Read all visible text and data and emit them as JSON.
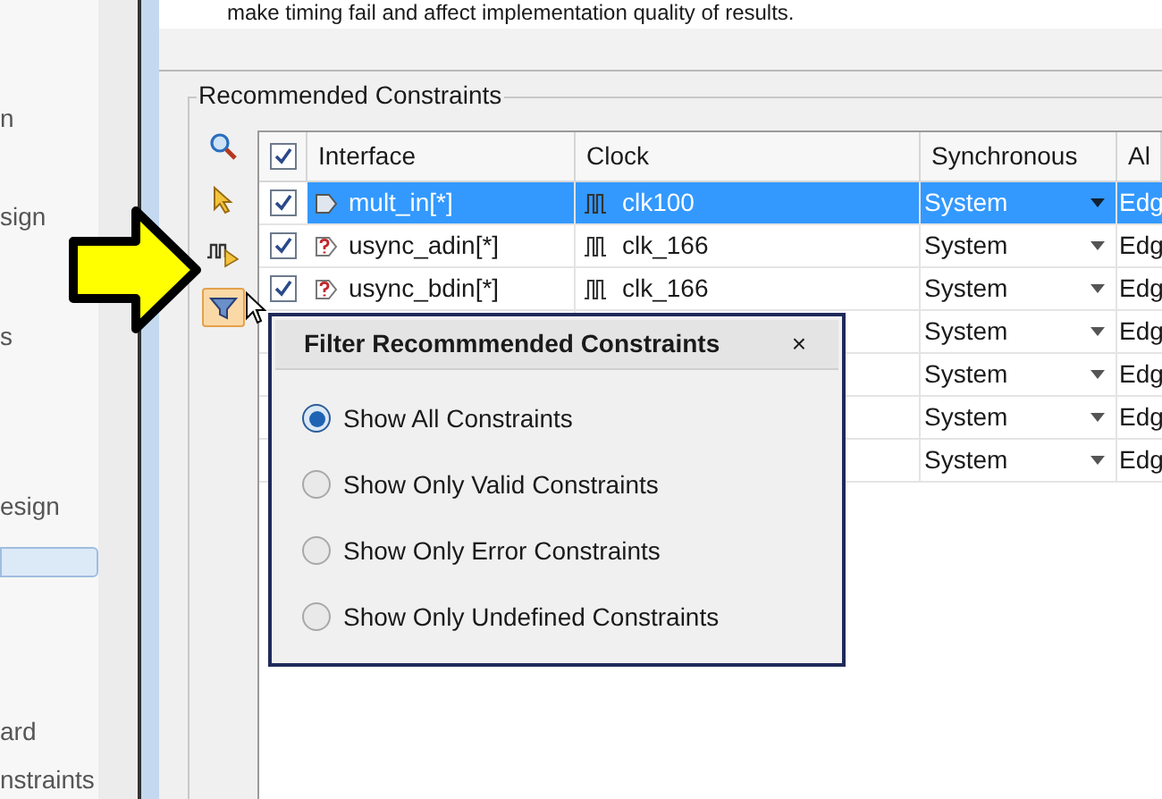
{
  "intro_text": "make timing fail and affect implementation quality of results.",
  "sidebar": {
    "items": [
      {
        "kind": "text",
        "label": "n",
        "selected": false
      },
      {
        "kind": "text",
        "label": "sign",
        "selected": false
      },
      {
        "kind": "text",
        "label": "s",
        "selected": false
      },
      {
        "kind": "text",
        "label": "esign",
        "selected": false
      },
      {
        "kind": "blank",
        "selected": true
      },
      {
        "kind": "text",
        "label": "ard",
        "selected": false
      },
      {
        "kind": "text",
        "label": "nstraints",
        "selected": false
      }
    ]
  },
  "group_title": "Recommended Constraints",
  "toolbar": [
    {
      "kind": "search",
      "active": false
    },
    {
      "kind": "select",
      "active": false
    },
    {
      "kind": "clock",
      "active": false
    },
    {
      "kind": "filter",
      "active": true
    }
  ],
  "table": {
    "header_checked": true,
    "columns": [
      "Interface",
      "Clock",
      "Synchronous",
      "Al"
    ],
    "rows": [
      {
        "checked": true,
        "selected": true,
        "kind": "valid",
        "interface": "mult_in[*]",
        "clock": "clk100",
        "synchronous": "System",
        "column_5": "Edg"
      },
      {
        "checked": true,
        "selected": false,
        "kind": "error",
        "interface": "usync_adin[*]",
        "clock": "clk_166",
        "synchronous": "System",
        "column_5": "Edg"
      },
      {
        "checked": true,
        "selected": false,
        "kind": "error",
        "interface": "usync_bdin[*]",
        "clock": "clk_166",
        "synchronous": "System",
        "column_5": "Edg"
      },
      {
        "selected": false,
        "kind": "hidden",
        "synchronous": "System",
        "column_5": "Edg"
      },
      {
        "selected": false,
        "kind": "hidden",
        "synchronous": "System",
        "column_5": "Edg"
      },
      {
        "selected": false,
        "kind": "hidden",
        "synchronous": "System",
        "column_5": "Edg"
      },
      {
        "selected": false,
        "kind": "hidden",
        "synchronous": "System",
        "column_5": "Edg"
      }
    ]
  },
  "popup": {
    "title": "Filter Recommmended Constraints",
    "close": "×",
    "options": [
      {
        "label": "Show All Constraints",
        "selected": true
      },
      {
        "label": "Show Only Valid Constraints",
        "selected": false
      },
      {
        "label": "Show Only Error Constraints",
        "selected": false
      },
      {
        "label": "Show Only Undefined Constraints",
        "selected": false
      }
    ]
  }
}
